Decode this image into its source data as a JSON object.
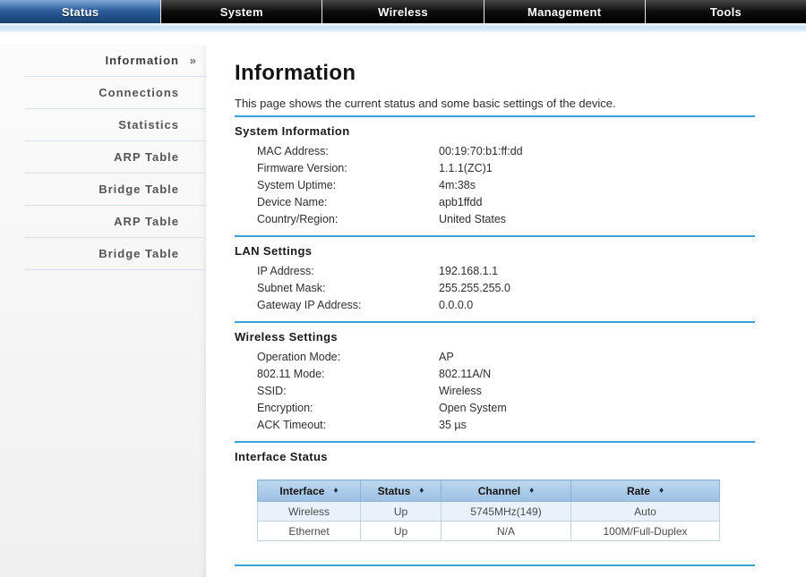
{
  "nav": {
    "tabs": [
      {
        "label": "Status",
        "active": true
      },
      {
        "label": "System",
        "active": false
      },
      {
        "label": "Wireless",
        "active": false
      },
      {
        "label": "Management",
        "active": false
      },
      {
        "label": "Tools",
        "active": false
      }
    ]
  },
  "sidebar": {
    "active_marker": "»",
    "items": [
      {
        "label": "Information",
        "active": true
      },
      {
        "label": "Connections",
        "active": false
      },
      {
        "label": "Statistics",
        "active": false
      },
      {
        "label": "ARP Table",
        "active": false
      },
      {
        "label": "Bridge Table",
        "active": false
      },
      {
        "label": "ARP Table",
        "active": false
      },
      {
        "label": "Bridge Table",
        "active": false
      }
    ]
  },
  "main": {
    "title": "Information",
    "description": "This page shows the current status and some basic settings of the device.",
    "sections": [
      {
        "heading": "System Information",
        "fields": [
          {
            "label": "MAC Address:",
            "value": "00:19:70:b1:ff:dd"
          },
          {
            "label": "Firmware Version:",
            "value": "1.1.1(ZC)1"
          },
          {
            "label": "System Uptime:",
            "value": "4m:38s"
          },
          {
            "label": "Device Name:",
            "value": "apb1ffdd"
          },
          {
            "label": "Country/Region:",
            "value": "United States"
          }
        ]
      },
      {
        "heading": "LAN Settings",
        "fields": [
          {
            "label": "IP Address:",
            "value": "192.168.1.1"
          },
          {
            "label": "Subnet Mask:",
            "value": "255.255.255.0"
          },
          {
            "label": "Gateway IP Address:",
            "value": "0.0.0.0"
          }
        ]
      },
      {
        "heading": "Wireless Settings",
        "fields": [
          {
            "label": "Operation Mode:",
            "value": "AP"
          },
          {
            "label": "802.11 Mode:",
            "value": "802.11A/N"
          },
          {
            "label": "SSID:",
            "value": "Wireless"
          },
          {
            "label": "Encryption:",
            "value": "Open System"
          },
          {
            "label": "ACK Timeout:",
            "value": "35 µs"
          }
        ]
      }
    ],
    "interface_status": {
      "heading": "Interface Status",
      "table": {
        "sort_icon": "♦",
        "columns": [
          "Interface",
          "Status",
          "Channel",
          "Rate"
        ],
        "rows": [
          [
            "Wireless",
            "Up",
            "5745MHz(149)",
            "Auto"
          ],
          [
            "Ethernet",
            "Up",
            "N/A",
            "100M/Full-Duplex"
          ]
        ]
      }
    }
  },
  "colors": {
    "nav_bg": "#000000",
    "active_tab_blue": "#2d5f9e",
    "accent_rule": "#35a3dc",
    "table_header_bg": "#a8c8e8",
    "row_alt_bg": "#e9f2fb"
  }
}
